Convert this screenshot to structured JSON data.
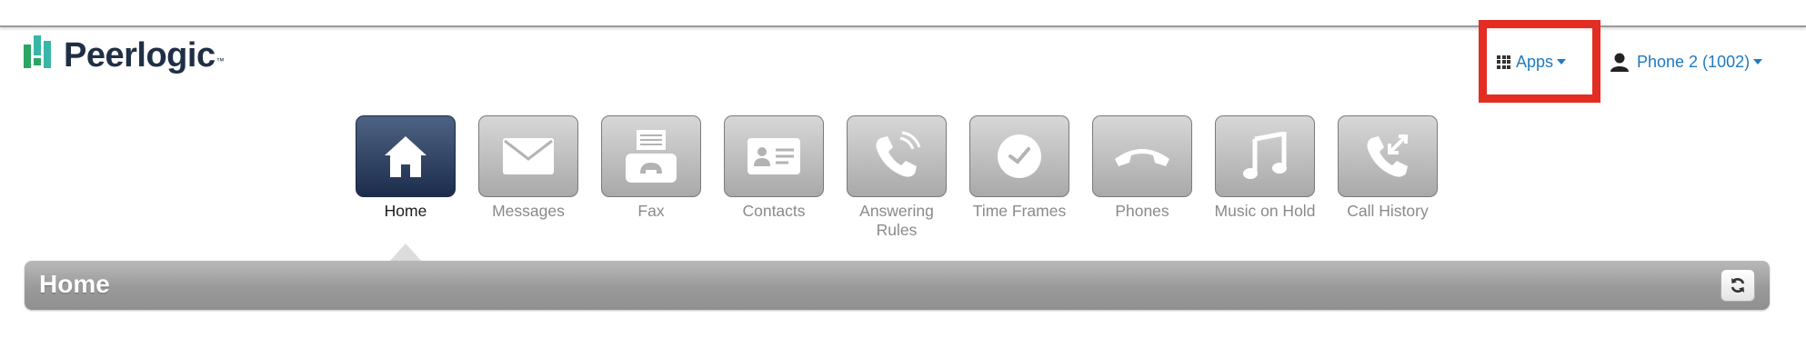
{
  "brand": {
    "name": "Peerlogic",
    "tm": "™"
  },
  "header": {
    "apps_label": "Apps",
    "user_label": "Phone 2 (1002)"
  },
  "nav": {
    "items": [
      {
        "label": "Home",
        "icon": "home-icon",
        "active": true
      },
      {
        "label": "Messages",
        "icon": "envelope-icon"
      },
      {
        "label": "Fax",
        "icon": "fax-icon"
      },
      {
        "label": "Contacts",
        "icon": "contact-card-icon"
      },
      {
        "label": "Answering Rules",
        "icon": "phone-forward-icon"
      },
      {
        "label": "Time Frames",
        "icon": "clock-icon"
      },
      {
        "label": "Phones",
        "icon": "handset-icon"
      },
      {
        "label": "Music on Hold",
        "icon": "music-note-icon"
      },
      {
        "label": "Call History",
        "icon": "call-history-icon"
      }
    ]
  },
  "section": {
    "title": "Home"
  },
  "colors": {
    "link": "#1e7ac2",
    "highlight": "#e32c22",
    "active_tile": "#1c2d4c",
    "brand_green": "#2aa564"
  }
}
